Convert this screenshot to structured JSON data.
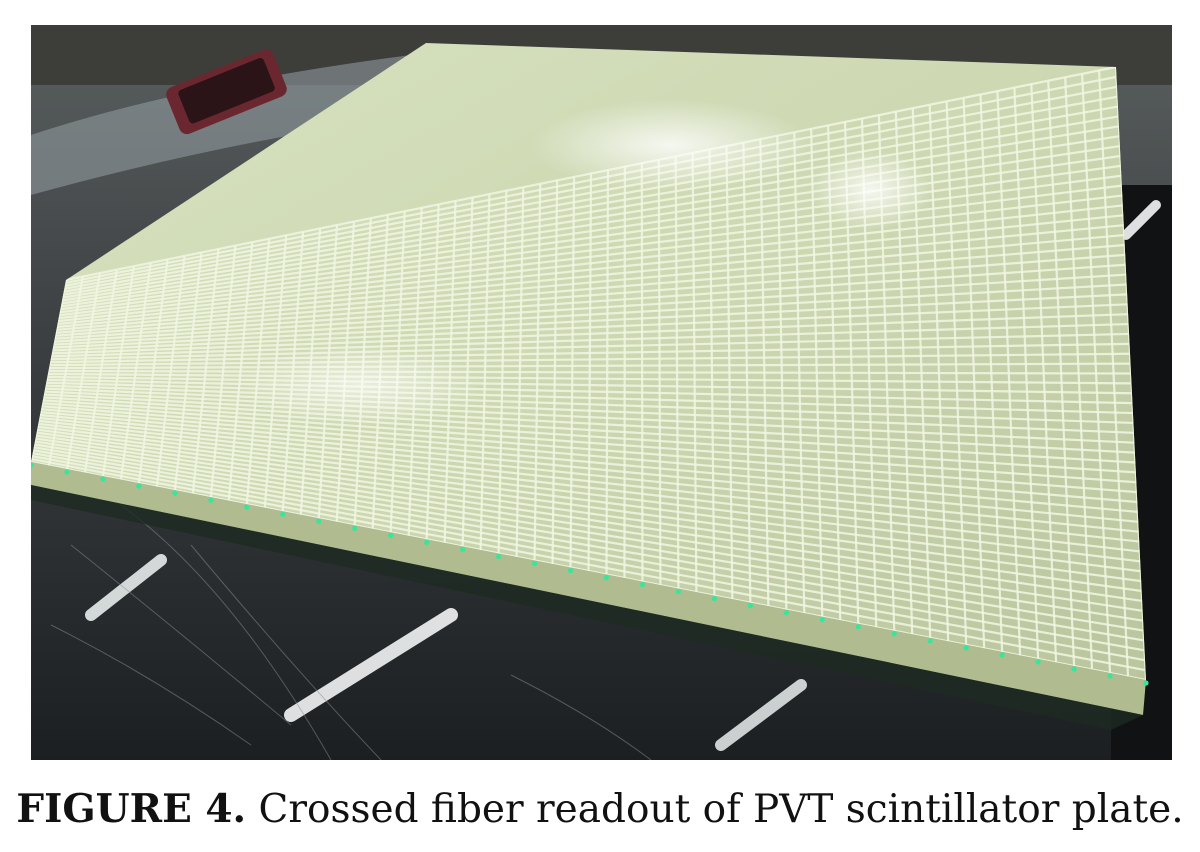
{
  "figure": {
    "label": "FIGURE 4.",
    "caption_text": "Crossed fiber readout of PVT scintillator plate."
  },
  "colors": {
    "plate": "#d4dfbd",
    "grid_line": "#f1f6e2",
    "fiber_glow": "#36e69a",
    "table": "#2d3134",
    "background": "#ffffff"
  }
}
